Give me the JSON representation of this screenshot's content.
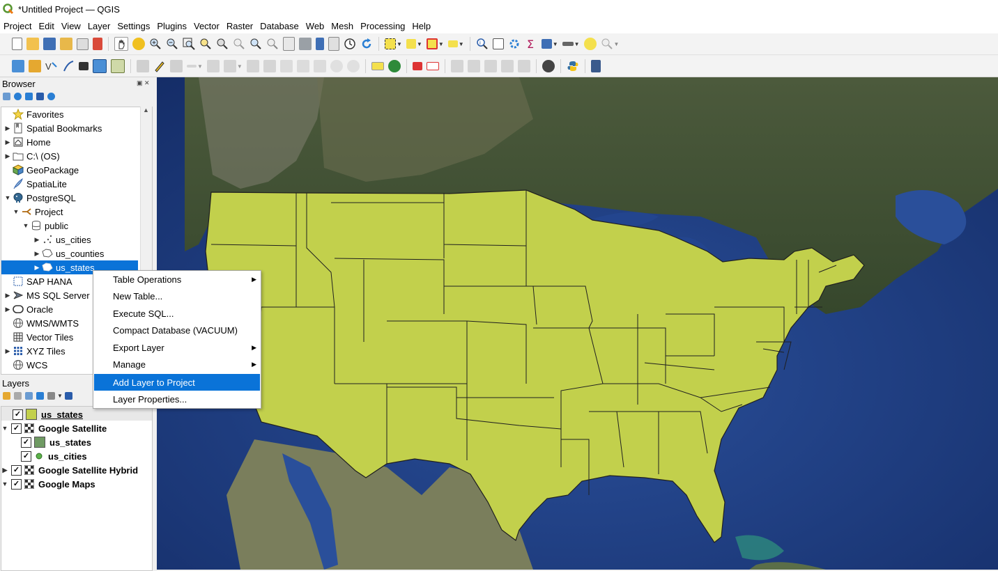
{
  "window": {
    "title": "*Untitled Project — QGIS"
  },
  "menu": [
    "Project",
    "Edit",
    "View",
    "Layer",
    "Settings",
    "Plugins",
    "Vector",
    "Raster",
    "Database",
    "Web",
    "Mesh",
    "Processing",
    "Help"
  ],
  "browser": {
    "title": "Browser",
    "items": [
      {
        "label": "Favorites",
        "icon": "star-icon"
      },
      {
        "label": "Spatial Bookmarks",
        "icon": "bookmark-icon"
      },
      {
        "label": "Home",
        "icon": "home-icon"
      },
      {
        "label": "C:\\ (OS)",
        "icon": "folder-icon"
      },
      {
        "label": "GeoPackage",
        "icon": "geopackage-icon"
      },
      {
        "label": "SpatiaLite",
        "icon": "feather-icon"
      },
      {
        "label": "PostgreSQL",
        "icon": "elephant-icon"
      },
      {
        "label": "Project",
        "icon": "connection-icon"
      },
      {
        "label": "public",
        "icon": "schema-icon"
      },
      {
        "label": "us_cities",
        "icon": "point-layer-icon"
      },
      {
        "label": "us_counties",
        "icon": "polygon-layer-icon"
      },
      {
        "label": "us_states",
        "icon": "polygon-layer-icon"
      },
      {
        "label": "SAP HANA",
        "icon": "sap-hana-icon"
      },
      {
        "label": "MS SQL Server",
        "icon": "mssql-icon"
      },
      {
        "label": "Oracle",
        "icon": "oracle-icon"
      },
      {
        "label": "WMS/WMTS",
        "icon": "globe-icon"
      },
      {
        "label": "Vector Tiles",
        "icon": "vector-tiles-icon"
      },
      {
        "label": "XYZ Tiles",
        "icon": "xyz-tiles-icon"
      },
      {
        "label": "WCS",
        "icon": "globe-icon"
      }
    ]
  },
  "layers": {
    "title": "Layers",
    "items": [
      {
        "label": "us_states",
        "icon": "polygon-fill-icon",
        "color": "#c2d04c",
        "checked": true
      },
      {
        "label": "Google Satellite",
        "icon": "raster-tile-icon",
        "checked": true
      },
      {
        "label": "us_states",
        "icon": "polygon-fill-icon",
        "color": "#6f9a63",
        "checked": true
      },
      {
        "label": "us_cities",
        "icon": "point-icon",
        "color": "#5cb34a",
        "checked": true
      },
      {
        "label": "Google Satellite Hybrid",
        "icon": "raster-tile-icon",
        "checked": true
      },
      {
        "label": "Google Maps",
        "icon": "raster-tile-icon",
        "checked": true
      }
    ]
  },
  "context_menu": {
    "items": [
      {
        "label": "Table Operations",
        "submenu": true
      },
      {
        "label": "New Table...",
        "submenu": false
      },
      {
        "label": "Execute SQL...",
        "submenu": false
      },
      {
        "label": "Compact Database (VACUUM)",
        "submenu": false
      },
      {
        "label": "Export Layer",
        "submenu": true
      },
      {
        "label": "Manage",
        "submenu": true
      },
      {
        "label": "Add Layer to Project",
        "submenu": false,
        "highlighted": true
      },
      {
        "label": "Layer Properties...",
        "submenu": false
      }
    ]
  },
  "colors": {
    "selection": "#0a73d8",
    "states_fill": "#c2d04c",
    "ocean": "#1d3b7e"
  }
}
